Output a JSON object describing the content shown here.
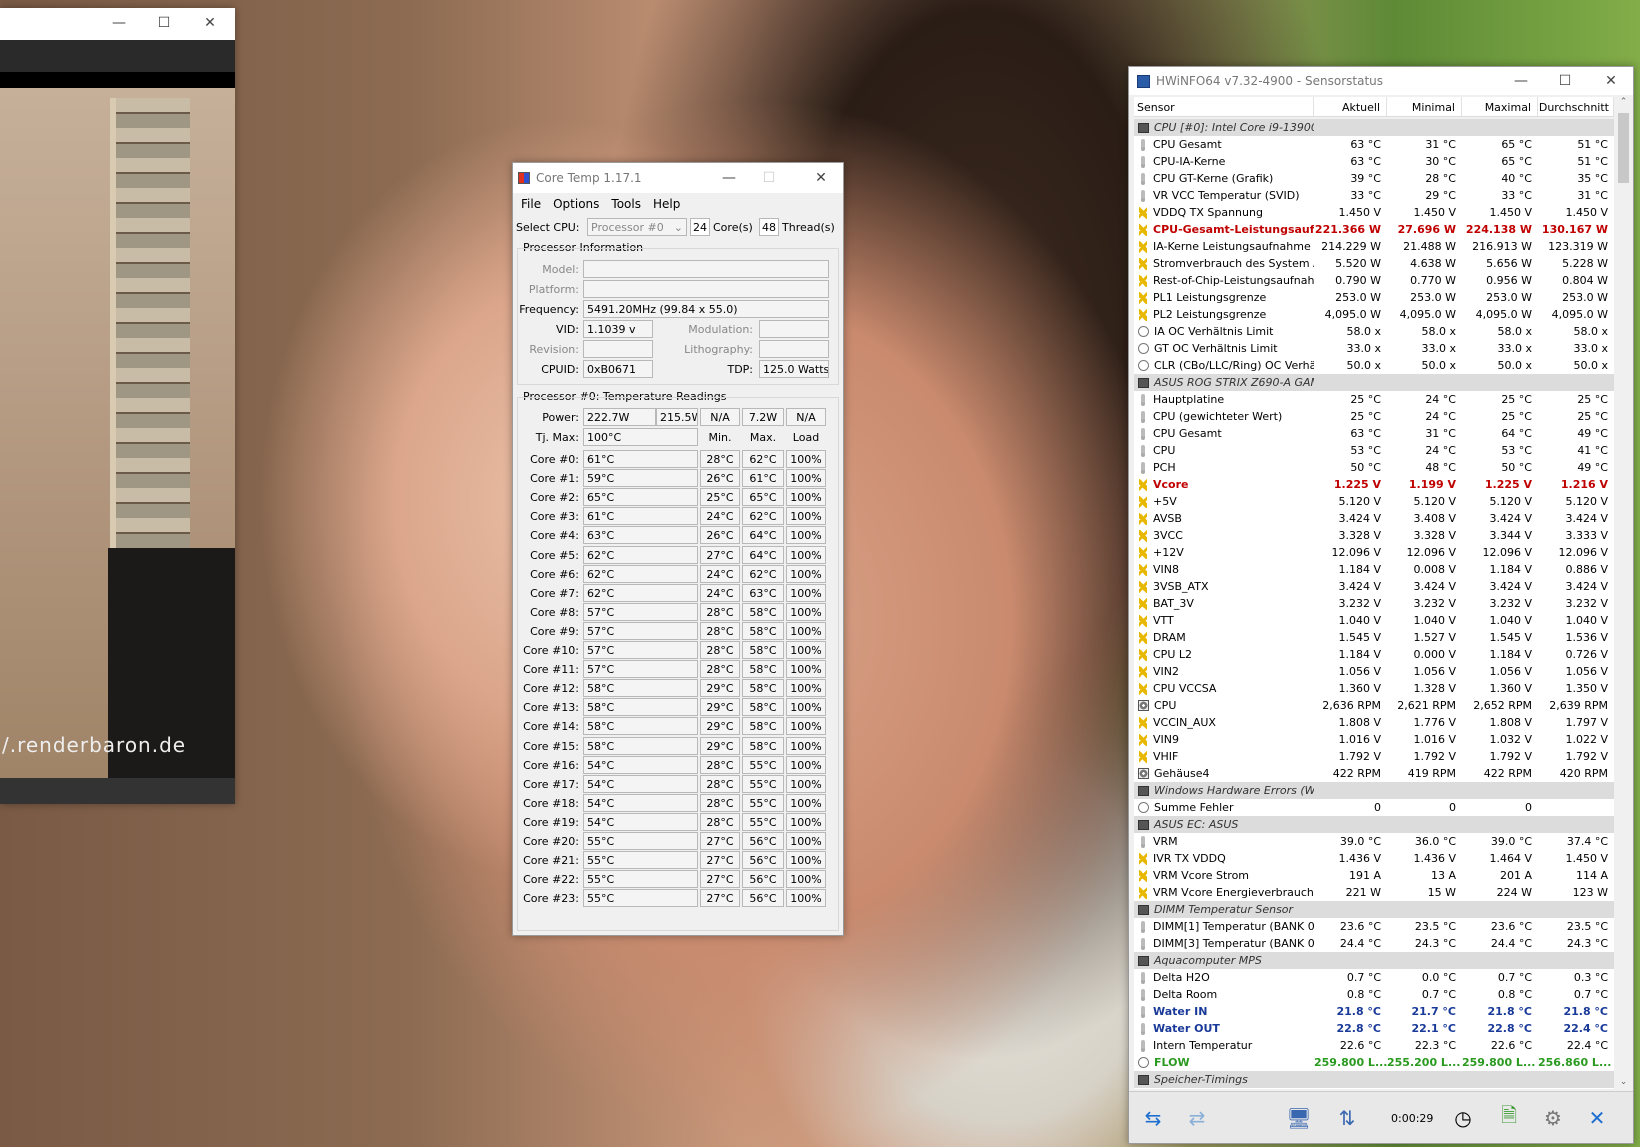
{
  "viewer": {
    "watermark": "/.renderbaron.de",
    "min": "—",
    "max": "☐",
    "close": "✕"
  },
  "coretemp": {
    "title": "Core Temp 1.17.1",
    "menu": [
      "File",
      "Options",
      "Tools",
      "Help"
    ],
    "select_cpu_label": "Select CPU:",
    "processor": "Processor #0",
    "cores": "24",
    "cores_label": "Core(s)",
    "threads": "48",
    "threads_label": "Thread(s)",
    "info_group": "Processor Information",
    "model_label": "Model:",
    "platform_label": "Platform:",
    "frequency_label": "Frequency:",
    "frequency": "5491.20MHz (99.84 x 55.0)",
    "vid_label": "VID:",
    "vid": "1.1039 v",
    "modulation_label": "Modulation:",
    "revision_label": "Revision:",
    "lithography_label": "Lithography:",
    "cpuid_label": "CPUID:",
    "cpuid": "0xB0671",
    "tdp_label": "TDP:",
    "tdp": "125.0 Watts",
    "temp_group": "Processor #0: Temperature Readings",
    "power_label": "Power:",
    "power": [
      "222.7W",
      "215.5W",
      "N/A",
      "7.2W",
      "N/A"
    ],
    "tjmax_label": "Tj. Max:",
    "tjmax": "100°C",
    "min_h": "Min.",
    "max_h": "Max.",
    "load_h": "Load",
    "cores_list": [
      {
        "name": "Core #0:",
        "cur": "61°C",
        "min": "28°C",
        "max": "62°C",
        "load": "100%"
      },
      {
        "name": "Core #1:",
        "cur": "59°C",
        "min": "26°C",
        "max": "61°C",
        "load": "100%"
      },
      {
        "name": "Core #2:",
        "cur": "65°C",
        "min": "25°C",
        "max": "65°C",
        "load": "100%"
      },
      {
        "name": "Core #3:",
        "cur": "61°C",
        "min": "24°C",
        "max": "62°C",
        "load": "100%"
      },
      {
        "name": "Core #4:",
        "cur": "63°C",
        "min": "26°C",
        "max": "64°C",
        "load": "100%"
      },
      {
        "name": "Core #5:",
        "cur": "62°C",
        "min": "27°C",
        "max": "64°C",
        "load": "100%"
      },
      {
        "name": "Core #6:",
        "cur": "62°C",
        "min": "24°C",
        "max": "62°C",
        "load": "100%"
      },
      {
        "name": "Core #7:",
        "cur": "62°C",
        "min": "24°C",
        "max": "63°C",
        "load": "100%"
      },
      {
        "name": "Core #8:",
        "cur": "57°C",
        "min": "28°C",
        "max": "58°C",
        "load": "100%"
      },
      {
        "name": "Core #9:",
        "cur": "57°C",
        "min": "28°C",
        "max": "58°C",
        "load": "100%"
      },
      {
        "name": "Core #10:",
        "cur": "57°C",
        "min": "28°C",
        "max": "58°C",
        "load": "100%"
      },
      {
        "name": "Core #11:",
        "cur": "57°C",
        "min": "28°C",
        "max": "58°C",
        "load": "100%"
      },
      {
        "name": "Core #12:",
        "cur": "58°C",
        "min": "29°C",
        "max": "58°C",
        "load": "100%"
      },
      {
        "name": "Core #13:",
        "cur": "58°C",
        "min": "29°C",
        "max": "58°C",
        "load": "100%"
      },
      {
        "name": "Core #14:",
        "cur": "58°C",
        "min": "29°C",
        "max": "58°C",
        "load": "100%"
      },
      {
        "name": "Core #15:",
        "cur": "58°C",
        "min": "29°C",
        "max": "58°C",
        "load": "100%"
      },
      {
        "name": "Core #16:",
        "cur": "54°C",
        "min": "28°C",
        "max": "55°C",
        "load": "100%"
      },
      {
        "name": "Core #17:",
        "cur": "54°C",
        "min": "28°C",
        "max": "55°C",
        "load": "100%"
      },
      {
        "name": "Core #18:",
        "cur": "54°C",
        "min": "28°C",
        "max": "55°C",
        "load": "100%"
      },
      {
        "name": "Core #19:",
        "cur": "54°C",
        "min": "28°C",
        "max": "55°C",
        "load": "100%"
      },
      {
        "name": "Core #20:",
        "cur": "55°C",
        "min": "27°C",
        "max": "56°C",
        "load": "100%"
      },
      {
        "name": "Core #21:",
        "cur": "55°C",
        "min": "27°C",
        "max": "56°C",
        "load": "100%"
      },
      {
        "name": "Core #22:",
        "cur": "55°C",
        "min": "27°C",
        "max": "56°C",
        "load": "100%"
      },
      {
        "name": "Core #23:",
        "cur": "55°C",
        "min": "27°C",
        "max": "56°C",
        "load": "100%"
      }
    ]
  },
  "hwinfo": {
    "title": "HWiNFO64 v7.32-4900 - Sensorstatus",
    "headers": [
      "Sensor",
      "Aktuell",
      "Minimal",
      "Maximal",
      "Durchschnitt"
    ],
    "rows": [
      {
        "t": "group",
        "i": "chip",
        "n": "CPU [#0]: Intel Core i9-13900...",
        "v": [
          "",
          "",
          "",
          ""
        ]
      },
      {
        "t": "",
        "i": "therm",
        "n": "CPU Gesamt",
        "v": [
          "63 °C",
          "31 °C",
          "65 °C",
          "51 °C"
        ]
      },
      {
        "t": "",
        "i": "therm",
        "n": "CPU-IA-Kerne",
        "v": [
          "63 °C",
          "30 °C",
          "65 °C",
          "51 °C"
        ]
      },
      {
        "t": "",
        "i": "therm",
        "n": "CPU GT-Kerne (Grafik)",
        "v": [
          "39 °C",
          "28 °C",
          "40 °C",
          "35 °C"
        ]
      },
      {
        "t": "",
        "i": "therm",
        "n": "VR VCC Temperatur (SVID)",
        "v": [
          "33 °C",
          "29 °C",
          "33 °C",
          "31 °C"
        ]
      },
      {
        "t": "",
        "i": "volt",
        "n": "VDDQ TX Spannung",
        "v": [
          "1.450 V",
          "1.450 V",
          "1.450 V",
          "1.450 V"
        ]
      },
      {
        "t": "red",
        "i": "volt",
        "n": "CPU-Gesamt-Leistungsauf...",
        "v": [
          "221.366 W",
          "27.696 W",
          "224.138 W",
          "130.167 W"
        ]
      },
      {
        "t": "",
        "i": "volt",
        "n": "IA-Kerne Leistungsaufnahme",
        "v": [
          "214.229 W",
          "21.488 W",
          "216.913 W",
          "123.319 W"
        ]
      },
      {
        "t": "",
        "i": "volt",
        "n": "Stromverbrauch des System A...",
        "v": [
          "5.520 W",
          "4.638 W",
          "5.656 W",
          "5.228 W"
        ]
      },
      {
        "t": "",
        "i": "volt",
        "n": "Rest-of-Chip-Leistungsaufnahme",
        "v": [
          "0.790 W",
          "0.770 W",
          "0.956 W",
          "0.804 W"
        ]
      },
      {
        "t": "",
        "i": "volt",
        "n": "PL1 Leistungsgrenze",
        "v": [
          "253.0 W",
          "253.0 W",
          "253.0 W",
          "253.0 W"
        ]
      },
      {
        "t": "",
        "i": "volt",
        "n": "PL2 Leistungsgrenze",
        "v": [
          "4,095.0 W",
          "4,095.0 W",
          "4,095.0 W",
          "4,095.0 W"
        ]
      },
      {
        "t": "",
        "i": "clock",
        "n": "IA OC Verhältnis Limit",
        "v": [
          "58.0 x",
          "58.0 x",
          "58.0 x",
          "58.0 x"
        ]
      },
      {
        "t": "",
        "i": "clock",
        "n": "GT OC Verhältnis Limit",
        "v": [
          "33.0 x",
          "33.0 x",
          "33.0 x",
          "33.0 x"
        ]
      },
      {
        "t": "",
        "i": "clock",
        "n": "CLR (CBo/LLC/Ring) OC Verhäl...",
        "v": [
          "50.0 x",
          "50.0 x",
          "50.0 x",
          "50.0 x"
        ]
      },
      {
        "t": "group",
        "i": "chip",
        "n": "ASUS ROG STRIX Z690-A GAM...",
        "v": [
          "",
          "",
          "",
          ""
        ]
      },
      {
        "t": "",
        "i": "therm",
        "n": "Hauptplatine",
        "v": [
          "25 °C",
          "24 °C",
          "25 °C",
          "25 °C"
        ]
      },
      {
        "t": "",
        "i": "therm",
        "n": "CPU (gewichteter Wert)",
        "v": [
          "25 °C",
          "24 °C",
          "25 °C",
          "25 °C"
        ]
      },
      {
        "t": "",
        "i": "therm",
        "n": "CPU Gesamt",
        "v": [
          "63 °C",
          "31 °C",
          "64 °C",
          "49 °C"
        ]
      },
      {
        "t": "",
        "i": "therm",
        "n": "CPU",
        "v": [
          "53 °C",
          "24 °C",
          "53 °C",
          "41 °C"
        ]
      },
      {
        "t": "",
        "i": "therm",
        "n": "PCH",
        "v": [
          "50 °C",
          "48 °C",
          "50 °C",
          "49 °C"
        ]
      },
      {
        "t": "red",
        "i": "volt",
        "n": "Vcore",
        "v": [
          "1.225 V",
          "1.199 V",
          "1.225 V",
          "1.216 V"
        ]
      },
      {
        "t": "",
        "i": "volt",
        "n": "+5V",
        "v": [
          "5.120 V",
          "5.120 V",
          "5.120 V",
          "5.120 V"
        ]
      },
      {
        "t": "",
        "i": "volt",
        "n": "AVSB",
        "v": [
          "3.424 V",
          "3.408 V",
          "3.424 V",
          "3.424 V"
        ]
      },
      {
        "t": "",
        "i": "volt",
        "n": "3VCC",
        "v": [
          "3.328 V",
          "3.328 V",
          "3.344 V",
          "3.333 V"
        ]
      },
      {
        "t": "",
        "i": "volt",
        "n": "+12V",
        "v": [
          "12.096 V",
          "12.096 V",
          "12.096 V",
          "12.096 V"
        ]
      },
      {
        "t": "",
        "i": "volt",
        "n": "VIN8",
        "v": [
          "1.184 V",
          "0.008 V",
          "1.184 V",
          "0.886 V"
        ]
      },
      {
        "t": "",
        "i": "volt",
        "n": "3VSB_ATX",
        "v": [
          "3.424 V",
          "3.424 V",
          "3.424 V",
          "3.424 V"
        ]
      },
      {
        "t": "",
        "i": "volt",
        "n": "BAT_3V",
        "v": [
          "3.232 V",
          "3.232 V",
          "3.232 V",
          "3.232 V"
        ]
      },
      {
        "t": "",
        "i": "volt",
        "n": "VTT",
        "v": [
          "1.040 V",
          "1.040 V",
          "1.040 V",
          "1.040 V"
        ]
      },
      {
        "t": "",
        "i": "volt",
        "n": "DRAM",
        "v": [
          "1.545 V",
          "1.527 V",
          "1.545 V",
          "1.536 V"
        ]
      },
      {
        "t": "",
        "i": "volt",
        "n": "CPU L2",
        "v": [
          "1.184 V",
          "0.000 V",
          "1.184 V",
          "0.726 V"
        ]
      },
      {
        "t": "",
        "i": "volt",
        "n": "VIN2",
        "v": [
          "1.056 V",
          "1.056 V",
          "1.056 V",
          "1.056 V"
        ]
      },
      {
        "t": "",
        "i": "volt",
        "n": "CPU VCCSA",
        "v": [
          "1.360 V",
          "1.328 V",
          "1.360 V",
          "1.350 V"
        ]
      },
      {
        "t": "",
        "i": "fan",
        "n": "CPU",
        "v": [
          "2,636 RPM",
          "2,621 RPM",
          "2,652 RPM",
          "2,639 RPM"
        ]
      },
      {
        "t": "",
        "i": "volt",
        "n": "VCCIN_AUX",
        "v": [
          "1.808 V",
          "1.776 V",
          "1.808 V",
          "1.797 V"
        ]
      },
      {
        "t": "",
        "i": "volt",
        "n": "VIN9",
        "v": [
          "1.016 V",
          "1.016 V",
          "1.032 V",
          "1.022 V"
        ]
      },
      {
        "t": "",
        "i": "volt",
        "n": "VHIF",
        "v": [
          "1.792 V",
          "1.792 V",
          "1.792 V",
          "1.792 V"
        ]
      },
      {
        "t": "",
        "i": "fan",
        "n": "Gehäuse4",
        "v": [
          "422 RPM",
          "419 RPM",
          "422 RPM",
          "420 RPM"
        ]
      },
      {
        "t": "group",
        "i": "chip",
        "n": "Windows Hardware Errors (W...",
        "v": [
          "",
          "",
          "",
          ""
        ]
      },
      {
        "t": "",
        "i": "clock",
        "n": "Summe Fehler",
        "v": [
          "0",
          "0",
          "0",
          ""
        ]
      },
      {
        "t": "group",
        "i": "chip",
        "n": "ASUS EC: ASUS",
        "v": [
          "",
          "",
          "",
          ""
        ]
      },
      {
        "t": "",
        "i": "therm",
        "n": "VRM",
        "v": [
          "39.0 °C",
          "36.0 °C",
          "39.0 °C",
          "37.4 °C"
        ]
      },
      {
        "t": "",
        "i": "volt",
        "n": "IVR TX VDDQ",
        "v": [
          "1.436 V",
          "1.436 V",
          "1.464 V",
          "1.450 V"
        ]
      },
      {
        "t": "",
        "i": "volt",
        "n": "VRM Vcore Strom",
        "v": [
          "191 A",
          "13 A",
          "201 A",
          "114 A"
        ]
      },
      {
        "t": "",
        "i": "volt",
        "n": "VRM Vcore Energieverbrauch",
        "v": [
          "221 W",
          "15 W",
          "224 W",
          "123 W"
        ]
      },
      {
        "t": "group",
        "i": "chip",
        "n": "DIMM Temperatur Sensor",
        "v": [
          "",
          "",
          "",
          ""
        ]
      },
      {
        "t": "",
        "i": "therm",
        "n": "DIMM[1] Temperatur (BANK 0/...",
        "v": [
          "23.6 °C",
          "23.5 °C",
          "23.6 °C",
          "23.5 °C"
        ]
      },
      {
        "t": "",
        "i": "therm",
        "n": "DIMM[3] Temperatur (BANK 0/...",
        "v": [
          "24.4 °C",
          "24.3 °C",
          "24.4 °C",
          "24.3 °C"
        ]
      },
      {
        "t": "group",
        "i": "chip",
        "n": "Aquacomputer MPS",
        "v": [
          "",
          "",
          "",
          ""
        ]
      },
      {
        "t": "",
        "i": "therm",
        "n": "Delta H2O",
        "v": [
          "0.7 °C",
          "0.0 °C",
          "0.7 °C",
          "0.3 °C"
        ]
      },
      {
        "t": "",
        "i": "therm",
        "n": "Delta Room",
        "v": [
          "0.8 °C",
          "0.7 °C",
          "0.8 °C",
          "0.7 °C"
        ]
      },
      {
        "t": "blue",
        "i": "therm",
        "n": "Water IN",
        "v": [
          "21.8 °C",
          "21.7 °C",
          "21.8 °C",
          "21.8 °C"
        ]
      },
      {
        "t": "blue",
        "i": "therm",
        "n": "Water OUT",
        "v": [
          "22.8 °C",
          "22.1 °C",
          "22.8 °C",
          "22.4 °C"
        ]
      },
      {
        "t": "",
        "i": "therm",
        "n": "Intern Temperatur",
        "v": [
          "22.6 °C",
          "22.3 °C",
          "22.6 °C",
          "22.4 °C"
        ]
      },
      {
        "t": "green",
        "i": "clock",
        "n": "FLOW",
        "v": [
          "259.800 L...",
          "255.200 L...",
          "259.800 L...",
          "256.860 L..."
        ]
      },
      {
        "t": "group",
        "i": "chip",
        "n": "Speicher-Timings",
        "v": [
          "",
          "",
          "",
          ""
        ]
      }
    ],
    "timer": "0:00:29"
  }
}
